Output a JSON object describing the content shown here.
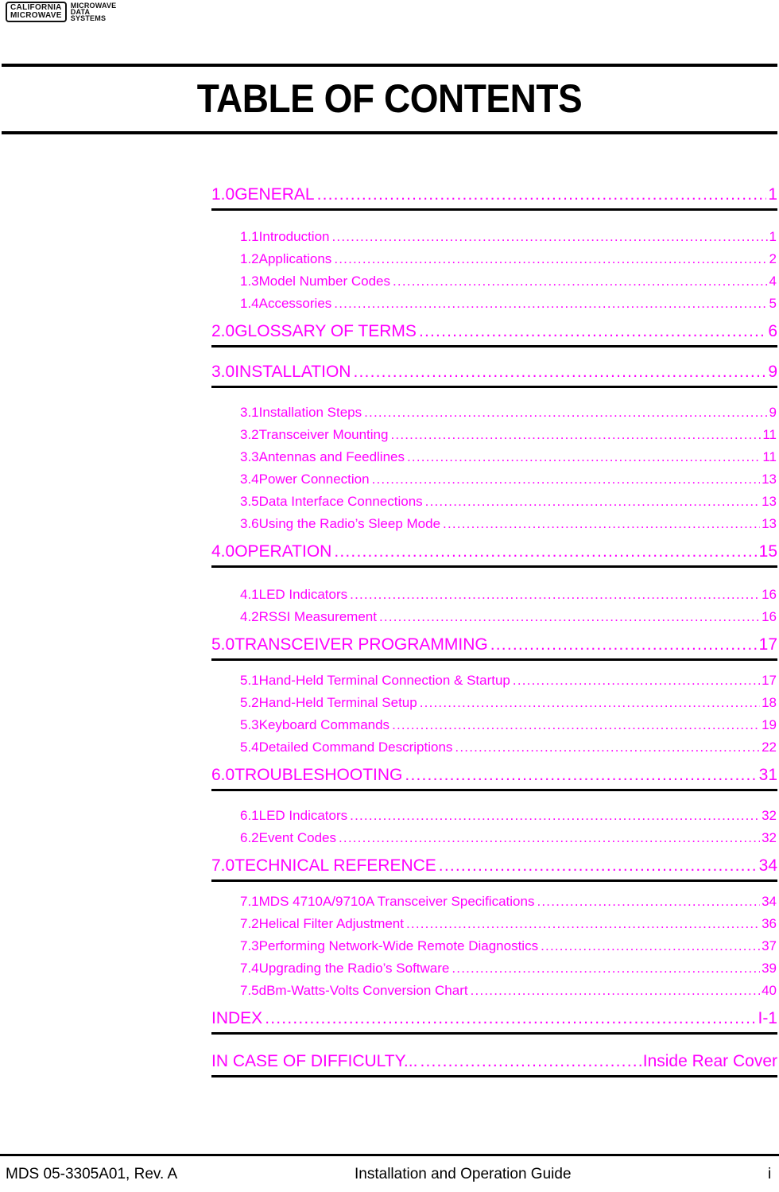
{
  "header": {
    "logo_box_line1": "CALIFORNIA",
    "logo_box_line2": "MICROWAVE",
    "logo_side_line1": "MICROWAVE",
    "logo_side_line2": "DATA",
    "logo_side_line3": "SYSTEMS"
  },
  "title": "TABLE OF CONTENTS",
  "colors": {
    "toc_text": "#ff00ff",
    "rules": "#000000"
  },
  "toc": [
    {
      "level": 1,
      "num": "1.0",
      "title": "GENERAL",
      "page": "1"
    },
    {
      "level": 2,
      "num": "1.1",
      "title": "Introduction",
      "page": "1"
    },
    {
      "level": 2,
      "num": "1.2",
      "title": "Applications",
      "page": "2"
    },
    {
      "level": 2,
      "num": "1.3",
      "title": "Model Number Codes",
      "page": "4"
    },
    {
      "level": 2,
      "num": "1.4",
      "title": "Accessories",
      "page": "5"
    },
    {
      "level": 1,
      "num": "2.0",
      "title": "GLOSSARY OF TERMS",
      "page": "6"
    },
    {
      "level": 1,
      "num": "3.0",
      "title": "INSTALLATION",
      "page": "9"
    },
    {
      "level": 2,
      "num": "3.1",
      "title": "Installation Steps",
      "page": "9"
    },
    {
      "level": 2,
      "num": "3.2",
      "title": "Transceiver Mounting",
      "page": "11"
    },
    {
      "level": 2,
      "num": "3.3",
      "title": "Antennas and Feedlines",
      "page": "11"
    },
    {
      "level": 2,
      "num": "3.4",
      "title": "Power Connection",
      "page": "13"
    },
    {
      "level": 2,
      "num": "3.5",
      "title": "Data Interface Connections",
      "page": "13"
    },
    {
      "level": 2,
      "num": "3.6",
      "title": "Using the Radio’s Sleep Mode",
      "page": "13"
    },
    {
      "level": 1,
      "num": "4.0",
      "title": "OPERATION",
      "page": "15"
    },
    {
      "level": 2,
      "num": "4.1",
      "title": "LED Indicators",
      "page": "16"
    },
    {
      "level": 2,
      "num": "4.2",
      "title": "RSSI Measurement",
      "page": "16"
    },
    {
      "level": 1,
      "num": "5.0",
      "title": "TRANSCEIVER PROGRAMMING",
      "page": "17"
    },
    {
      "level": 2,
      "num": "5.1",
      "title": "Hand-Held Terminal Connection & Startup",
      "page": "17"
    },
    {
      "level": 2,
      "num": "5.2",
      "title": "Hand-Held Terminal Setup",
      "page": "18"
    },
    {
      "level": 2,
      "num": "5.3",
      "title": "Keyboard Commands",
      "page": "19"
    },
    {
      "level": 2,
      "num": "5.4",
      "title": "Detailed Command Descriptions",
      "page": "22"
    },
    {
      "level": 1,
      "num": "6.0",
      "title": "TROUBLESHOOTING",
      "page": "31"
    },
    {
      "level": 2,
      "num": "6.1",
      "title": "LED Indicators",
      "page": "32"
    },
    {
      "level": 2,
      "num": "6.2",
      "title": "Event Codes",
      "page": "32"
    },
    {
      "level": 1,
      "num": "7.0",
      "title": "TECHNICAL REFERENCE",
      "page": "34"
    },
    {
      "level": 2,
      "num": "7.1",
      "title": "MDS 4710A/9710A Transceiver Specifications",
      "page": "34"
    },
    {
      "level": 2,
      "num": "7.2",
      "title": "Helical Filter Adjustment",
      "page": "36"
    },
    {
      "level": 2,
      "num": "7.3",
      "title": "Performing Network-Wide Remote Diagnostics",
      "page": "37"
    },
    {
      "level": 2,
      "num": "7.4",
      "title": "Upgrading the Radio’s Software",
      "page": "39"
    },
    {
      "level": 2,
      "num": "7.5",
      "title": "dBm-Watts-Volts Conversion Chart",
      "page": "40"
    },
    {
      "level": 1,
      "num": "",
      "title": "INDEX",
      "page": "I-1"
    },
    {
      "level": 1,
      "num": "",
      "title": "IN CASE OF DIFFICULTY...",
      "page": "Inside Rear Cover"
    }
  ],
  "footer": {
    "left": "MDS 05-3305A01, Rev. A",
    "center": "Installation and Operation Guide",
    "right": "i"
  }
}
